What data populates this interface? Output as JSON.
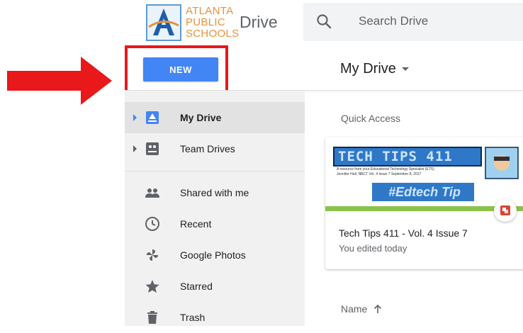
{
  "header": {
    "logo_lines": [
      "ATLANTA",
      "PUBLIC",
      "SCHOOLS"
    ],
    "app_title": "Drive",
    "search_placeholder": "Search Drive"
  },
  "toolbar": {
    "new_label": "NEW",
    "location_title": "My Drive"
  },
  "sidebar": {
    "items": [
      {
        "label": "My Drive",
        "icon": "my-drive-icon",
        "expandable": true,
        "active": true
      },
      {
        "label": "Team Drives",
        "icon": "team-drives-icon",
        "expandable": true,
        "active": false
      },
      {
        "label": "Shared with me",
        "icon": "people-icon",
        "expandable": false,
        "active": false
      },
      {
        "label": "Recent",
        "icon": "clock-icon",
        "expandable": false,
        "active": false
      },
      {
        "label": "Google Photos",
        "icon": "pinwheel-icon",
        "expandable": false,
        "active": false
      },
      {
        "label": "Starred",
        "icon": "star-icon",
        "expandable": false,
        "active": false
      },
      {
        "label": "Trash",
        "icon": "trash-icon",
        "expandable": false,
        "active": false
      }
    ]
  },
  "main": {
    "quick_access_label": "Quick Access",
    "file_card": {
      "thumbnail_title": "TECH TIPS 411",
      "thumbnail_subtitle": "A resource from your Educational Technology Specialist (ETS)",
      "thumbnail_byline": "Jennifer Hall, NBCT   Vol. 4 Issue 7   September 8, 2017",
      "thumbnail_banner": "#Edtech Tip",
      "name": "Tech Tips 411 - Vol. 4 Issue 7",
      "meta": "You edited today"
    },
    "sort_label": "Name"
  },
  "colors": {
    "accent": "#4285f4",
    "annotation_red": "#e8181b",
    "logo_orange": "#e8913a",
    "sidebar_bg": "#f1f1f1"
  }
}
